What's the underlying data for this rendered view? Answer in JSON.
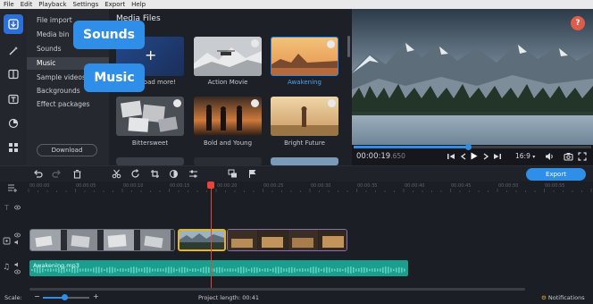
{
  "menubar": {
    "items": [
      "File",
      "Edit",
      "Playback",
      "Settings",
      "Export",
      "Help"
    ]
  },
  "sidebar": {
    "items": [
      {
        "label": "File import"
      },
      {
        "label": "Media bin"
      },
      {
        "label": "Sounds"
      },
      {
        "label": "Music"
      },
      {
        "label": "Sample videos"
      },
      {
        "label": "Backgrounds"
      },
      {
        "label": "Effect packages"
      }
    ],
    "download_label": "Download"
  },
  "callouts": {
    "sounds": "Sounds",
    "music": "Music"
  },
  "media": {
    "title": "Media Files",
    "tiles": [
      {
        "caption": "Download more!"
      },
      {
        "caption": "Action Movie"
      },
      {
        "caption": "Awakening"
      },
      {
        "caption": "Bittersweet"
      },
      {
        "caption": "Bold and Young"
      },
      {
        "caption": "Bright Future"
      }
    ]
  },
  "preview": {
    "help": "?",
    "time_main": "00:00:19",
    "time_ms": ".650",
    "aspect": "16:9",
    "progress": 0.48
  },
  "toolbar": {
    "export_label": "Export"
  },
  "timeline": {
    "ticks": [
      "00:00:00",
      "00:00:05",
      "00:00:10",
      "00:00:15",
      "00:00:20",
      "00:00:25",
      "00:00:30",
      "00:00:35",
      "00:00:40",
      "00:00:45",
      "00:00:50",
      "00:00:55"
    ],
    "audio_clip": "Awakening.mp3"
  },
  "status": {
    "scale_label": "Scale:",
    "project_length": "Project length: 00:41",
    "notifications": "Notifications"
  },
  "colors": {
    "accent": "#2e8ee8",
    "audio": "#1b9e8e",
    "playhead": "#e6453a"
  }
}
